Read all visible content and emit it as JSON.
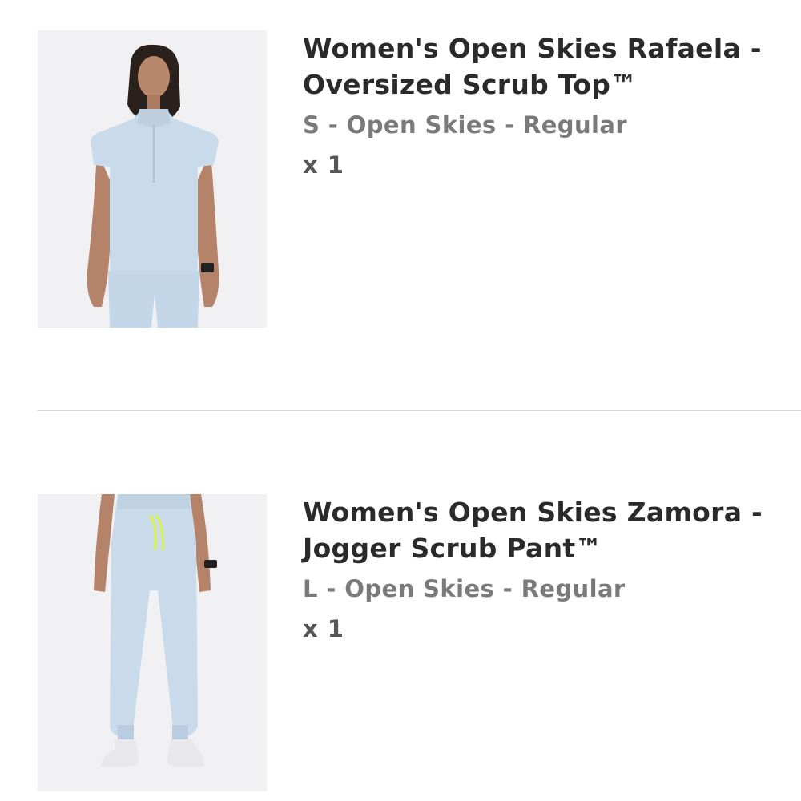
{
  "cart": {
    "items": [
      {
        "title": "Women's Open Skies Rafaela - Oversized Scrub Top™",
        "variant": "S - Open Skies - Regular",
        "quantity": "x 1",
        "image": "product-photo-scrub-top",
        "color": "#c9dbea"
      },
      {
        "title": "Women's Open Skies Zamora - Jogger Scrub Pant™",
        "variant": "L - Open Skies - Regular",
        "quantity": "x 1",
        "image": "product-photo-jogger-pant",
        "color": "#c9dbea"
      }
    ]
  }
}
